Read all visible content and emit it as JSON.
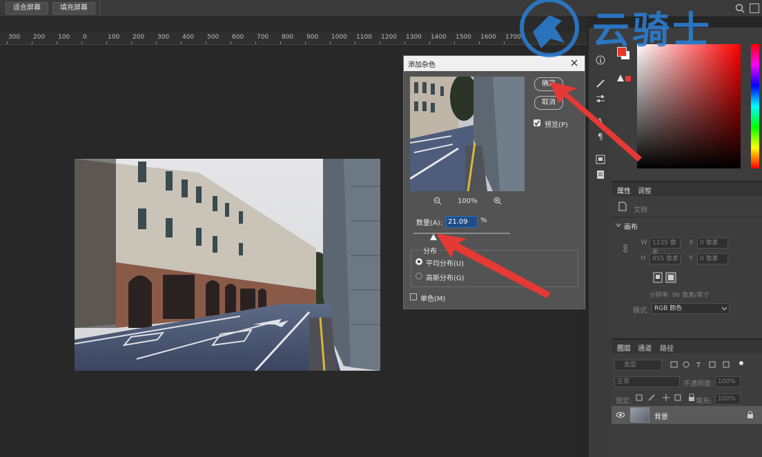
{
  "optionsbar": {
    "fit_screen": "适合屏幕",
    "fill_screen": "填充屏幕"
  },
  "ruler": {
    "ticks": [
      "300",
      "200",
      "100",
      "0",
      "100",
      "200",
      "300",
      "400",
      "500",
      "600",
      "700",
      "800",
      "900",
      "1000",
      "1100",
      "1200",
      "1300",
      "1400",
      "1500",
      "1600",
      "1700"
    ]
  },
  "watermark": {
    "text": "云骑士"
  },
  "dialog": {
    "title": "添加杂色",
    "ok": "确定",
    "cancel": "取消",
    "preview_label": "预览(P)",
    "zoom": "100%",
    "amount_label": "数量(A):",
    "amount_value": "21.09",
    "amount_unit": "%",
    "amount_fraction": 0.21,
    "distribution_title": "分布",
    "uniform": "平均分布(U)",
    "gaussian": "高斯分布(G)",
    "mono": "单色(M)"
  },
  "properties": {
    "tab_props": "属性",
    "tab_adjust": "调整",
    "doc_label": "文档",
    "canvas_label": "画布",
    "w_label": "W",
    "w_value": "1235 像素",
    "x_label": "X",
    "x_value": "0 像素",
    "h_label": "H",
    "h_value": "855 像素",
    "y_label": "Y",
    "y_value": "0 像素",
    "resolution": "分辨率: 96 像素/英寸",
    "mode_label": "模式",
    "mode_value": "RGB 颜色"
  },
  "layers": {
    "tab_layers": "图层",
    "tab_channels": "通道",
    "tab_paths": "路径",
    "filter_placeholder": "类型",
    "blend": "正常",
    "opacity_label": "不透明度:",
    "opacity_value": "100%",
    "lock_label": "锁定:",
    "fill_label": "填充:",
    "fill_value": "100%",
    "layer_name": "背景"
  },
  "colors": {
    "accent": "#e53935",
    "fg": "#e8382c",
    "dialog_bg": "#535353"
  }
}
